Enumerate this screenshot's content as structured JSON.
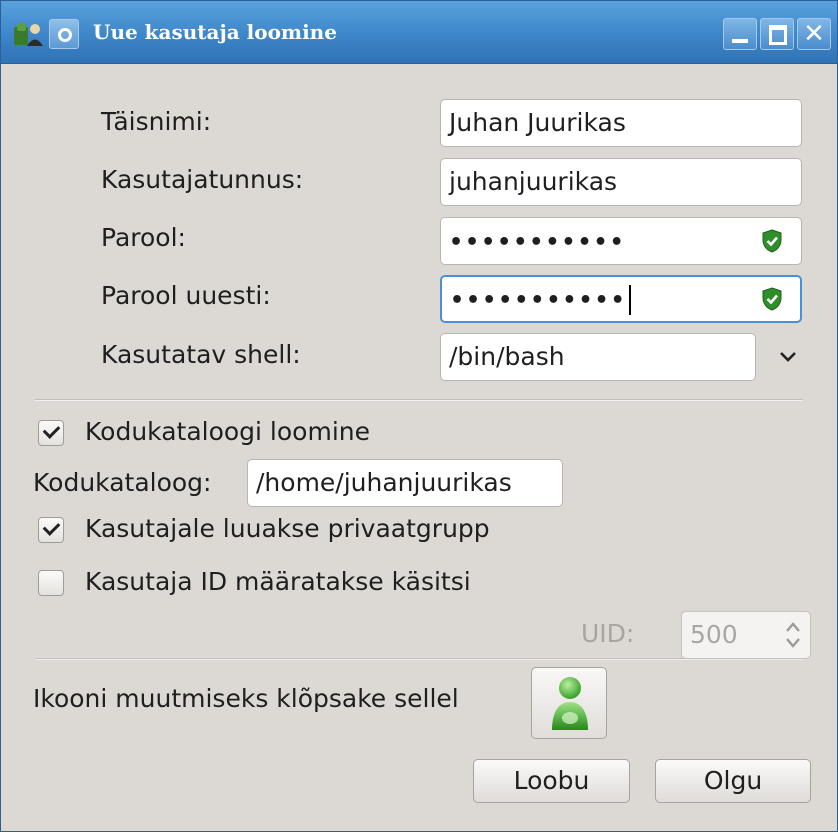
{
  "window": {
    "title": "Uue kasutaja loomine",
    "icons": {
      "app": "users-icon",
      "menu": "window-menu-icon",
      "minimize": "minimize-icon",
      "maximize": "maximize-icon",
      "close": "close-icon"
    },
    "accent_color": "#3d86c9"
  },
  "form": {
    "fullname_label": "Täisnimi:",
    "fullname_value": "Juhan Juurikas",
    "username_label": "Kasutajatunnus:",
    "username_value": "juhanjuurikas",
    "password_label": "Parool:",
    "password_value": "•••••••••••",
    "password_repeat_label": "Parool uuesti:",
    "password_repeat_value": "•••••••••••",
    "password_strength_icon": "shield-check-icon",
    "shell_label": "Kasutatav shell:",
    "shell_value": "/bin/bash"
  },
  "home": {
    "create_home_label": "Kodukataloogi loomine",
    "create_home_checked": true,
    "home_dir_label": "Kodukataloog:",
    "home_dir_value": "/home/juhanjuurikas",
    "private_group_label": "Kasutajale luuakse privaatgrupp",
    "private_group_checked": true,
    "manual_uid_label": "Kasutaja ID määratakse käsitsi",
    "manual_uid_checked": false,
    "uid_label": "UID:",
    "uid_value": "500"
  },
  "icon_section": {
    "label": "Ikooni muutmiseks klõpsake sellel",
    "avatar_icon": "user-avatar-icon"
  },
  "buttons": {
    "cancel": "Loobu",
    "ok": "Olgu"
  }
}
